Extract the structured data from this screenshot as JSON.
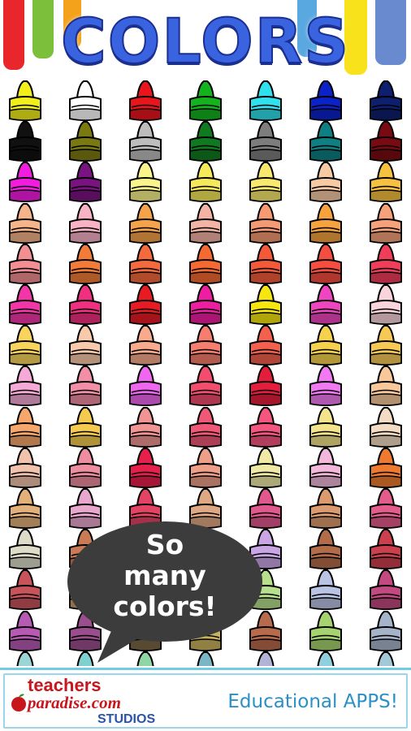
{
  "title": "COLORS",
  "bubble": {
    "lines": [
      "So",
      "many",
      "colors!"
    ]
  },
  "footer": {
    "logo_line1": "teachers",
    "logo_line2": "paradise.com",
    "logo_line3": "STUDIOS",
    "tagline": "Educational APPS!"
  },
  "drip_colors": [
    "#e8262b",
    "#7bbf3a",
    "#f4a21c",
    "#5aa8e0",
    "#f7e21b",
    "#6a8ad0"
  ],
  "crayon_colors": [
    [
      "#f2ee1a",
      "#ffffff",
      "#e8151c",
      "#13b31e",
      "#2fe0ee",
      "#0a22c8",
      "#0d1f6e"
    ],
    [
      "#111111",
      "#7b7a10",
      "#bdbdbd",
      "#0f7a20",
      "#7d7d7d",
      "#0e7f82",
      "#7a0a12"
    ],
    [
      "#f21ce0",
      "#7a1281",
      "#f9f58a",
      "#f5e85a",
      "#f8e86e",
      "#f6cba4",
      "#f6c040"
    ],
    [
      "#f5b48a",
      "#f8b2c6",
      "#f5a34a",
      "#f3b3a5",
      "#f59a72",
      "#f5a23f",
      "#f5a27b"
    ],
    [
      "#f38f92",
      "#f27b38",
      "#f56a3c",
      "#f56a30",
      "#f45a3a",
      "#f54d3f",
      "#f03d5a"
    ],
    [
      "#f236a7",
      "#f12f80",
      "#e81b25",
      "#ee1ea1",
      "#f5e60f",
      "#ef45c0",
      "#f8d4dc"
    ],
    [
      "#f9d45c",
      "#f8c9ab",
      "#f8aa8c",
      "#f67e6e",
      "#f3604e",
      "#f6d24c",
      "#f6c957"
    ],
    [
      "#f5a9d6",
      "#f28ea5",
      "#ef66f0",
      "#f24d6e",
      "#e51d3d",
      "#f17af3",
      "#f8c89a"
    ],
    [
      "#f6a76b",
      "#f5cb4f",
      "#f09593",
      "#ef5876",
      "#f45680",
      "#f3e38a",
      "#f3dcc3"
    ],
    [
      "#f2c3ac",
      "#ef8da0",
      "#e61f4d",
      "#ee9f88",
      "#efe9a5",
      "#f2b7da",
      "#ef7a2f"
    ],
    [
      "#e3b07a",
      "#eaa7cd",
      "#e54363",
      "#dea883",
      "#e0588e",
      "#dc9b6f",
      "#e35c8b"
    ],
    [
      "#dcdcc8",
      "#c97b55",
      "#6e5b44",
      "#e08c79",
      "#c9a5e6",
      "#b36c4a",
      "#cc3f4d"
    ],
    [
      "#c8535b",
      "#c69b6e",
      "#5b4a3d",
      "#c0d8a8",
      "#b8e08c",
      "#b9c3e3",
      "#c24a80"
    ],
    [
      "#b85ab3",
      "#9b4e8d",
      "#7a6646",
      "#c8b25d",
      "#b86a4c",
      "#a6d36f",
      "#a6b4c9"
    ],
    [
      "#9ad6d6",
      "#7fd1d0",
      "#8fd6a5",
      "#7ab6c6",
      "#b3b3d6",
      "#8fcfdf",
      "#a2c9d8"
    ]
  ]
}
